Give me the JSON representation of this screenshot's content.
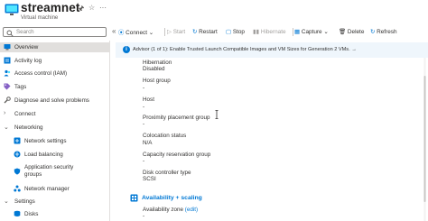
{
  "header": {
    "title": "streamnet",
    "subtitle": "Virtual machine",
    "pin_icon": "pin-icon",
    "star_icon": "star-icon",
    "more_icon": "more-icon"
  },
  "sidebar": {
    "search_placeholder": "Search",
    "items": [
      {
        "label": "Overview",
        "icon": "overview-icon"
      },
      {
        "label": "Activity log",
        "icon": "activity-log-icon"
      },
      {
        "label": "Access control (IAM)",
        "icon": "iam-icon"
      },
      {
        "label": "Tags",
        "icon": "tag-icon"
      },
      {
        "label": "Diagnose and solve problems",
        "icon": "wrench-icon"
      },
      {
        "label": "Connect",
        "icon": "chevron-right-icon"
      },
      {
        "label": "Networking",
        "icon": "chevron-down-icon"
      },
      {
        "label": "Network settings",
        "icon": "network-settings-icon"
      },
      {
        "label": "Load balancing",
        "icon": "load-balancing-icon"
      },
      {
        "label": "Application security",
        "label2": "groups",
        "icon": "asg-icon"
      },
      {
        "label": "Network manager",
        "icon": "network-manager-icon"
      },
      {
        "label": "Settings",
        "icon": "chevron-down-icon"
      },
      {
        "label": "Disks",
        "icon": "disks-icon"
      }
    ]
  },
  "toolbar": {
    "connect": "Connect",
    "start": "Start",
    "restart": "Restart",
    "stop": "Stop",
    "hibernate": "Hibernate",
    "capture": "Capture",
    "delete": "Delete",
    "refresh": "Refresh"
  },
  "banner": {
    "text": "Advisor (1 of 1): Enable Trusted Launch Compatible Images and VM Sizes for Generation 2 VMs.",
    "arrow": "→"
  },
  "properties": {
    "hibernation_label": "Hibernation",
    "hibernation_value": "Disabled",
    "host_group_label": "Host group",
    "host_group_value": "-",
    "host_label": "Host",
    "host_value": "-",
    "ppg_label": "Proximity placement group",
    "ppg_value": "-",
    "colocation_label": "Colocation status",
    "colocation_value": "N/A",
    "crg_label": "Capacity reservation group",
    "crg_value": "-",
    "disk_ctrl_label": "Disk controller type",
    "disk_ctrl_value": "SCSI",
    "section_availability": "Availability + scaling",
    "az_label": "Availability zone",
    "az_edit": "(edit)",
    "az_value": "-"
  },
  "colors": {
    "accent": "#0078d4",
    "selected_bg": "#e1dfdd",
    "banner_bg": "#eff6fc"
  }
}
